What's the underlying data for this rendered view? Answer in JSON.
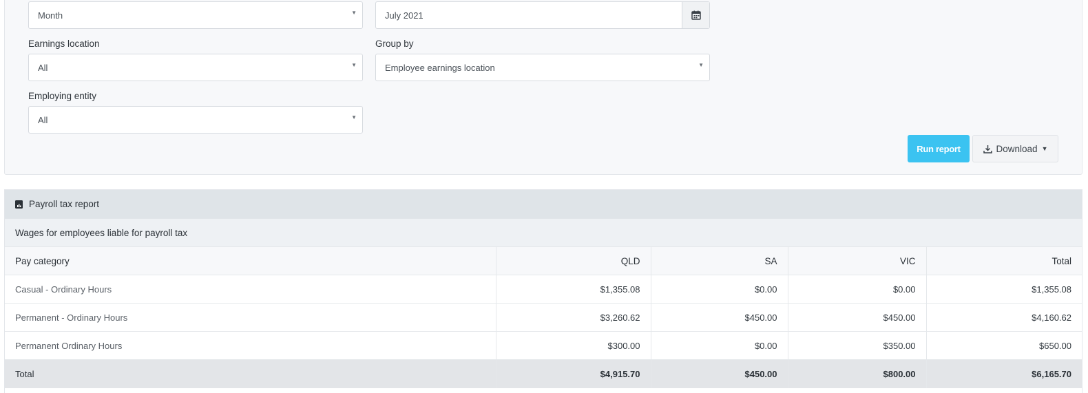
{
  "filters": {
    "period_type": "Month",
    "period_value": "July 2021",
    "earnings_location": {
      "label": "Earnings location",
      "value": "All"
    },
    "group_by": {
      "label": "Group by",
      "value": "Employee earnings location"
    },
    "employing_entity": {
      "label": "Employing entity",
      "value": "All"
    }
  },
  "actions": {
    "run_report": "Run report",
    "download": "Download"
  },
  "report": {
    "title": "Payroll tax report",
    "subtitle": "Wages for employees liable for payroll tax",
    "columns": [
      "Pay category",
      "QLD",
      "SA",
      "VIC",
      "Total"
    ],
    "rows": [
      [
        "Casual - Ordinary Hours",
        "$1,355.08",
        "$0.00",
        "$0.00",
        "$1,355.08"
      ],
      [
        "Permanent - Ordinary Hours",
        "$3,260.62",
        "$450.00",
        "$450.00",
        "$4,160.62"
      ],
      [
        "Permanent Ordinary Hours",
        "$300.00",
        "$0.00",
        "$350.00",
        "$650.00"
      ]
    ],
    "total_row": [
      "Total",
      "$4,915.70",
      "$450.00",
      "$800.00",
      "$6,165.70"
    ]
  },
  "icons": {
    "calendar": "calendar-icon",
    "download": "download-icon",
    "report": "report-icon"
  },
  "colors": {
    "accent": "#3bc3f1"
  }
}
